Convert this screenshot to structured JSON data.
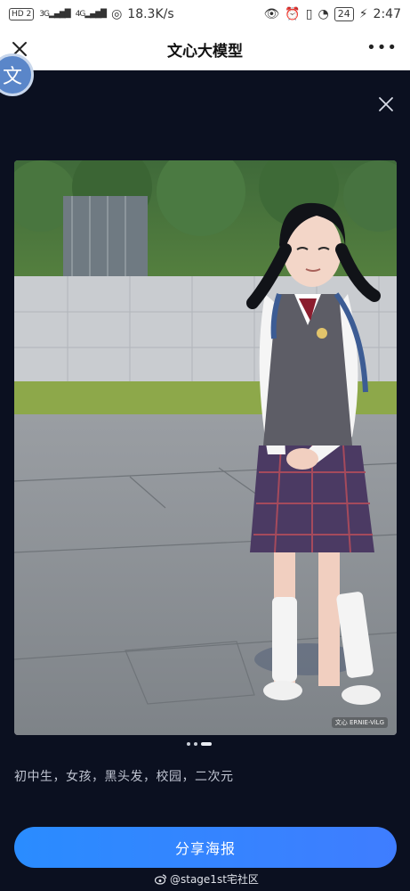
{
  "status_bar": {
    "hd": "HD 2",
    "net1": "3G",
    "net2": "4G",
    "speed": "18.3K/s",
    "battery": "24",
    "time": "2:47"
  },
  "nav": {
    "title": "文心大模型",
    "more": "•••"
  },
  "float_avatar": {
    "glyph": "文"
  },
  "image": {
    "watermark": "文心 ERNIE-ViLG",
    "pager_dots": 3
  },
  "prompt": {
    "text": "初中生，女孩，黑头发，校园，二次元"
  },
  "share": {
    "label": "分享海报"
  },
  "footer": {
    "weibo": "@stage1st宅社区"
  },
  "colors": {
    "accent": "#2a8cff",
    "background": "#0b1020",
    "prompt_text": "#c0c5d2"
  }
}
